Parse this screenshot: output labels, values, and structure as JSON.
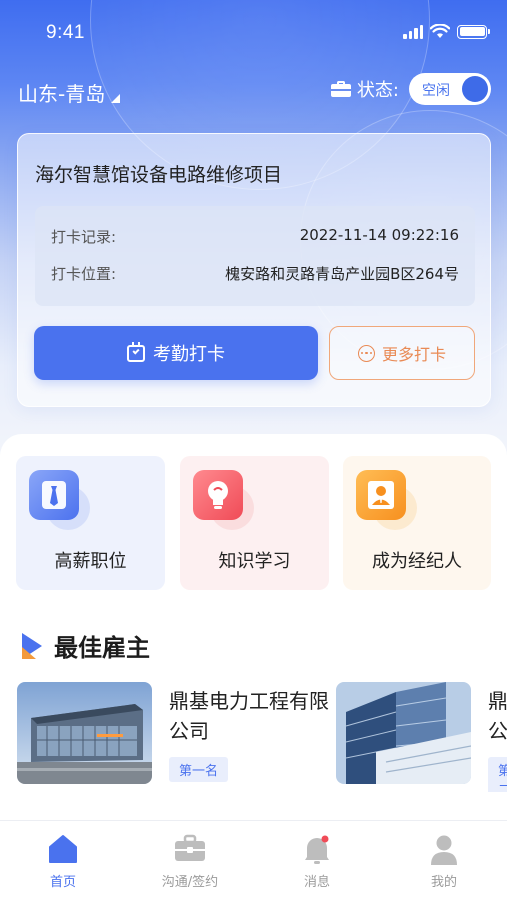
{
  "status_bar": {
    "time": "9:41"
  },
  "header": {
    "location": "山东-青岛",
    "state_label": "状态:",
    "state_value": "空闲"
  },
  "checkin_card": {
    "project": "海尔智慧馆设备电路维修项目",
    "record_label": "打卡记录:",
    "record_value": "2022-11-14 09:22:16",
    "location_label": "打卡位置:",
    "location_value": "槐安路和灵路青岛产业园B区264号",
    "primary_button": "考勤打卡",
    "secondary_button": "更多打卡"
  },
  "quick_tiles": [
    {
      "label": "高薪职位",
      "icon": "tie-icon"
    },
    {
      "label": "知识学习",
      "icon": "lightbulb-icon"
    },
    {
      "label": "成为经纪人",
      "icon": "agent-icon"
    }
  ],
  "employers_section": {
    "title": "最佳雇主",
    "items": [
      {
        "name": "鼎基电力工程有限公司",
        "rank": "第一名"
      },
      {
        "name": "鼎基电力工程有限公司",
        "rank": "第二名"
      }
    ]
  },
  "tabbar": {
    "items": [
      {
        "label": "首页",
        "icon": "home-icon",
        "active": true
      },
      {
        "label": "沟通/签约",
        "icon": "briefcase-icon",
        "active": false
      },
      {
        "label": "消息",
        "icon": "bell-icon",
        "active": false
      },
      {
        "label": "我的",
        "icon": "person-icon",
        "active": false
      }
    ]
  },
  "colors": {
    "accent": "#4a72ee",
    "orange": "#e98a55",
    "red": "#f04b57"
  }
}
